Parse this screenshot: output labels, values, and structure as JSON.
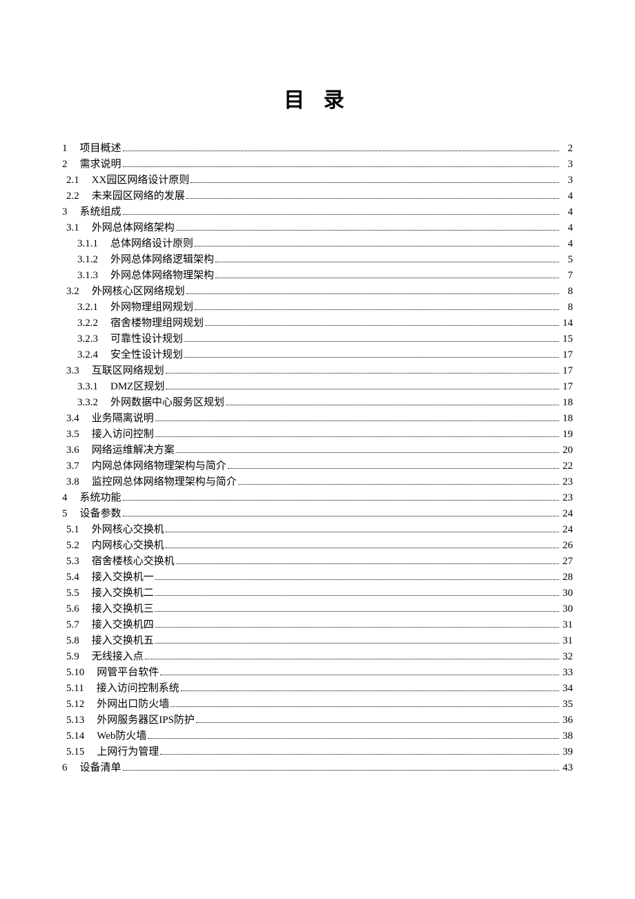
{
  "title": "目 录",
  "entries": [
    {
      "num": "1",
      "label": "项目概述",
      "page": "2",
      "level": 1
    },
    {
      "num": "2",
      "label": "需求说明",
      "page": "3",
      "level": 1
    },
    {
      "num": "2.1",
      "label": "XX园区网络设计原则",
      "page": "3",
      "level": 2
    },
    {
      "num": "2.2",
      "label": "未来园区网络的发展",
      "page": "4",
      "level": 2
    },
    {
      "num": "3",
      "label": "系统组成",
      "page": "4",
      "level": 1
    },
    {
      "num": "3.1",
      "label": "外网总体网络架构",
      "page": "4",
      "level": 2
    },
    {
      "num": "3.1.1",
      "label": "总体网络设计原则",
      "page": "4",
      "level": 3
    },
    {
      "num": "3.1.2",
      "label": "外网总体网络逻辑架构",
      "page": "5",
      "level": 3
    },
    {
      "num": "3.1.3",
      "label": "外网总体网络物理架构",
      "page": "7",
      "level": 3
    },
    {
      "num": "3.2",
      "label": "外网核心区网络规划",
      "page": "8",
      "level": 2
    },
    {
      "num": "3.2.1",
      "label": "外网物理组网规划",
      "page": "8",
      "level": 3
    },
    {
      "num": "3.2.2",
      "label": "宿舍楼物理组网规划",
      "page": "14",
      "level": 3
    },
    {
      "num": "3.2.3",
      "label": "可靠性设计规划",
      "page": "15",
      "level": 3
    },
    {
      "num": "3.2.4",
      "label": "安全性设计规划",
      "page": "17",
      "level": 3
    },
    {
      "num": "3.3",
      "label": "互联区网络规划",
      "page": "17",
      "level": 2
    },
    {
      "num": "3.3.1",
      "label": "DMZ区规划",
      "page": "17",
      "level": 3
    },
    {
      "num": "3.3.2",
      "label": "外网数据中心服务区规划",
      "page": "18",
      "level": 3
    },
    {
      "num": "3.4",
      "label": "业务隔离说明",
      "page": "18",
      "level": 2
    },
    {
      "num": "3.5",
      "label": "接入访问控制",
      "page": "19",
      "level": 2
    },
    {
      "num": "3.6",
      "label": "网络运维解决方案",
      "page": "20",
      "level": 2
    },
    {
      "num": "3.7",
      "label": "内网总体网络物理架构与简介",
      "page": "22",
      "level": 2
    },
    {
      "num": "3.8",
      "label": "监控网总体网络物理架构与简介",
      "page": "23",
      "level": 2
    },
    {
      "num": "4",
      "label": "系统功能",
      "page": "23",
      "level": 1
    },
    {
      "num": "5",
      "label": "设备参数",
      "page": "24",
      "level": 1
    },
    {
      "num": "5.1",
      "label": "外网核心交换机",
      "page": "24",
      "level": 2
    },
    {
      "num": "5.2",
      "label": "内网核心交换机",
      "page": "26",
      "level": 2
    },
    {
      "num": "5.3",
      "label": "宿舍楼核心交换机",
      "page": "27",
      "level": 2
    },
    {
      "num": "5.4",
      "label": "接入交换机一",
      "page": "28",
      "level": 2
    },
    {
      "num": "5.5",
      "label": "接入交换机二",
      "page": "30",
      "level": 2
    },
    {
      "num": "5.6",
      "label": "接入交换机三",
      "page": "30",
      "level": 2
    },
    {
      "num": "5.7",
      "label": "接入交换机四",
      "page": "31",
      "level": 2
    },
    {
      "num": "5.8",
      "label": "接入交换机五",
      "page": "31",
      "level": 2
    },
    {
      "num": "5.9",
      "label": "无线接入点",
      "page": "32",
      "level": 2
    },
    {
      "num": "5.10",
      "label": "网管平台软件",
      "page": "33",
      "level": 2
    },
    {
      "num": "5.11",
      "label": "接入访问控制系统",
      "page": "34",
      "level": 2
    },
    {
      "num": "5.12",
      "label": "外网出口防火墙",
      "page": "35",
      "level": 2
    },
    {
      "num": "5.13",
      "label": "外网服务器区IPS防护",
      "page": "36",
      "level": 2
    },
    {
      "num": "5.14",
      "label": "Web防火墙",
      "page": "38",
      "level": 2
    },
    {
      "num": "5.15",
      "label": "上网行为管理",
      "page": "39",
      "level": 2
    },
    {
      "num": "6",
      "label": "设备清单",
      "page": "43",
      "level": 1
    }
  ]
}
